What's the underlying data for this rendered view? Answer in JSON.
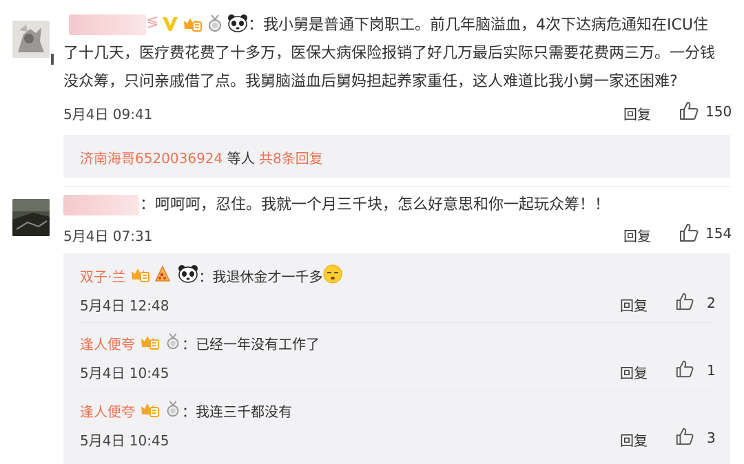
{
  "comments": [
    {
      "sep": "：",
      "text_lines": [
        "我小舅是普通下岗职工。前几年脑溢血，4次下达病危通知在ICU住",
        "了十几天，医疗费花费了十多万，医保大病保险报销了好几万最后实际只需要花费两三万。一分钱",
        "没众筹，只问亲戚借了点。我舅脑溢血后舅妈担起养家重任，这人难道比我小舅一家还困难?"
      ],
      "time": "5月4日 09:41",
      "reply_label": "回复",
      "likes": "150",
      "more_replies": {
        "user": "济南海哥6520036924",
        "mid": " 等人 ",
        "count": "共8条回复"
      }
    },
    {
      "sep": "：",
      "text": "呵呵呵，忍住。我就一个月三千块，怎么好意思和你一起玩众筹！！",
      "time": "5月4日 07:31",
      "reply_label": "回复",
      "likes": "154"
    }
  ],
  "replies": [
    {
      "user": "双子·兰",
      "sep": "：",
      "text": "我退休金才一千多",
      "time": "5月4日 12:48",
      "reply_label": "回复",
      "likes": "2"
    },
    {
      "user": "逢人便夸",
      "sep": "：",
      "text": "已经一年没有工作了",
      "time": "5月4日 10:45",
      "reply_label": "回复",
      "likes": "1"
    },
    {
      "user": "逢人便夸",
      "sep": "：",
      "text": "我连三千都没有",
      "time": "5月4日 10:45",
      "reply_label": "回复",
      "likes": "3"
    }
  ],
  "icons": {
    "vip_v": "verified-v-icon",
    "vip_crown": "crown-badge-icon",
    "medal": "medal-icon",
    "panda": "panda-emoji-icon",
    "like": "thumbs-up-icon",
    "speechless": "speechless-emoji-icon",
    "pizza": "pizza-badge-icon"
  },
  "colors": {
    "username": "#eb7350",
    "reply_panel": "#f2f2f5",
    "accent_gold": "#f5a623"
  }
}
